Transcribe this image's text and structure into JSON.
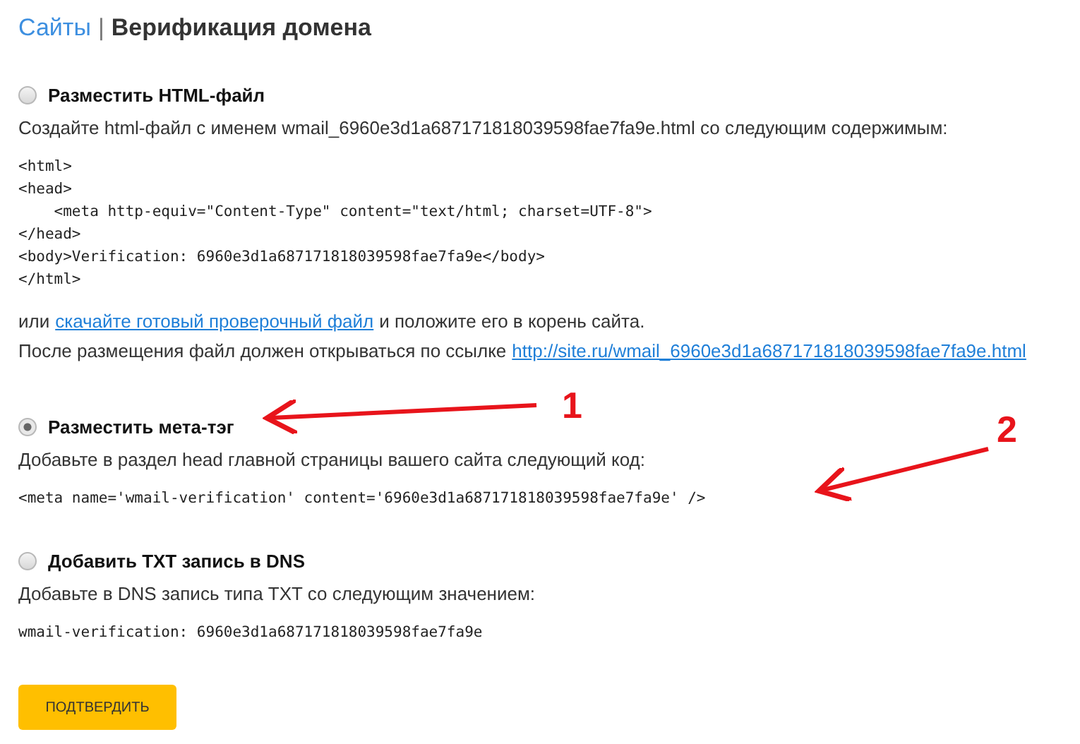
{
  "breadcrumb": {
    "parent": "Сайты",
    "separator": "|",
    "current": "Верификация домена"
  },
  "options": [
    {
      "label": "Разместить HTML-файл",
      "selected": false,
      "blocks": [
        {
          "kind": "text",
          "text": "Создайте html-файл с именем wmail_6960e3d1a687171818039598fae7fa9e.html со следующим содержимым:"
        },
        {
          "kind": "code",
          "lines": [
            "<html>",
            "<head>",
            "    <meta http-equiv=\"Content-Type\" content=\"text/html; charset=UTF-8\">",
            "</head>",
            "<body>Verification: 6960e3d1a687171818039598fae7fa9e</body>",
            "</html>"
          ]
        },
        {
          "kind": "linked",
          "before": "или",
          "link": "скачайте готовый проверочный файл",
          "after": "и положите его в корень сайта."
        },
        {
          "kind": "linked",
          "before": "После размещения файл должен открываться по ссылке",
          "link": "http://site.ru/wmail_6960e3d1a687171818039598fae7fa9e.html"
        }
      ]
    },
    {
      "label": "Разместить мета-тэг",
      "selected": true,
      "blocks": [
        {
          "kind": "text",
          "text": "Добавьте в раздел head главной страницы вашего сайта следующий код:"
        },
        {
          "kind": "code",
          "lines": [
            "<meta name='wmail-verification' content='6960e3d1a687171818039598fae7fa9e' />"
          ]
        }
      ]
    },
    {
      "label": "Добавить TXT запись в DNS",
      "selected": false,
      "blocks": [
        {
          "kind": "text",
          "text": "Добавьте в DNS запись типа TXT со следующим значением:"
        },
        {
          "kind": "code",
          "lines": [
            "wmail-verification: 6960e3d1a687171818039598fae7fa9e"
          ]
        }
      ]
    }
  ],
  "confirm_button": "ПОДТВЕРДИТЬ",
  "annotations": [
    {
      "label": "1"
    },
    {
      "label": "2"
    }
  ]
}
